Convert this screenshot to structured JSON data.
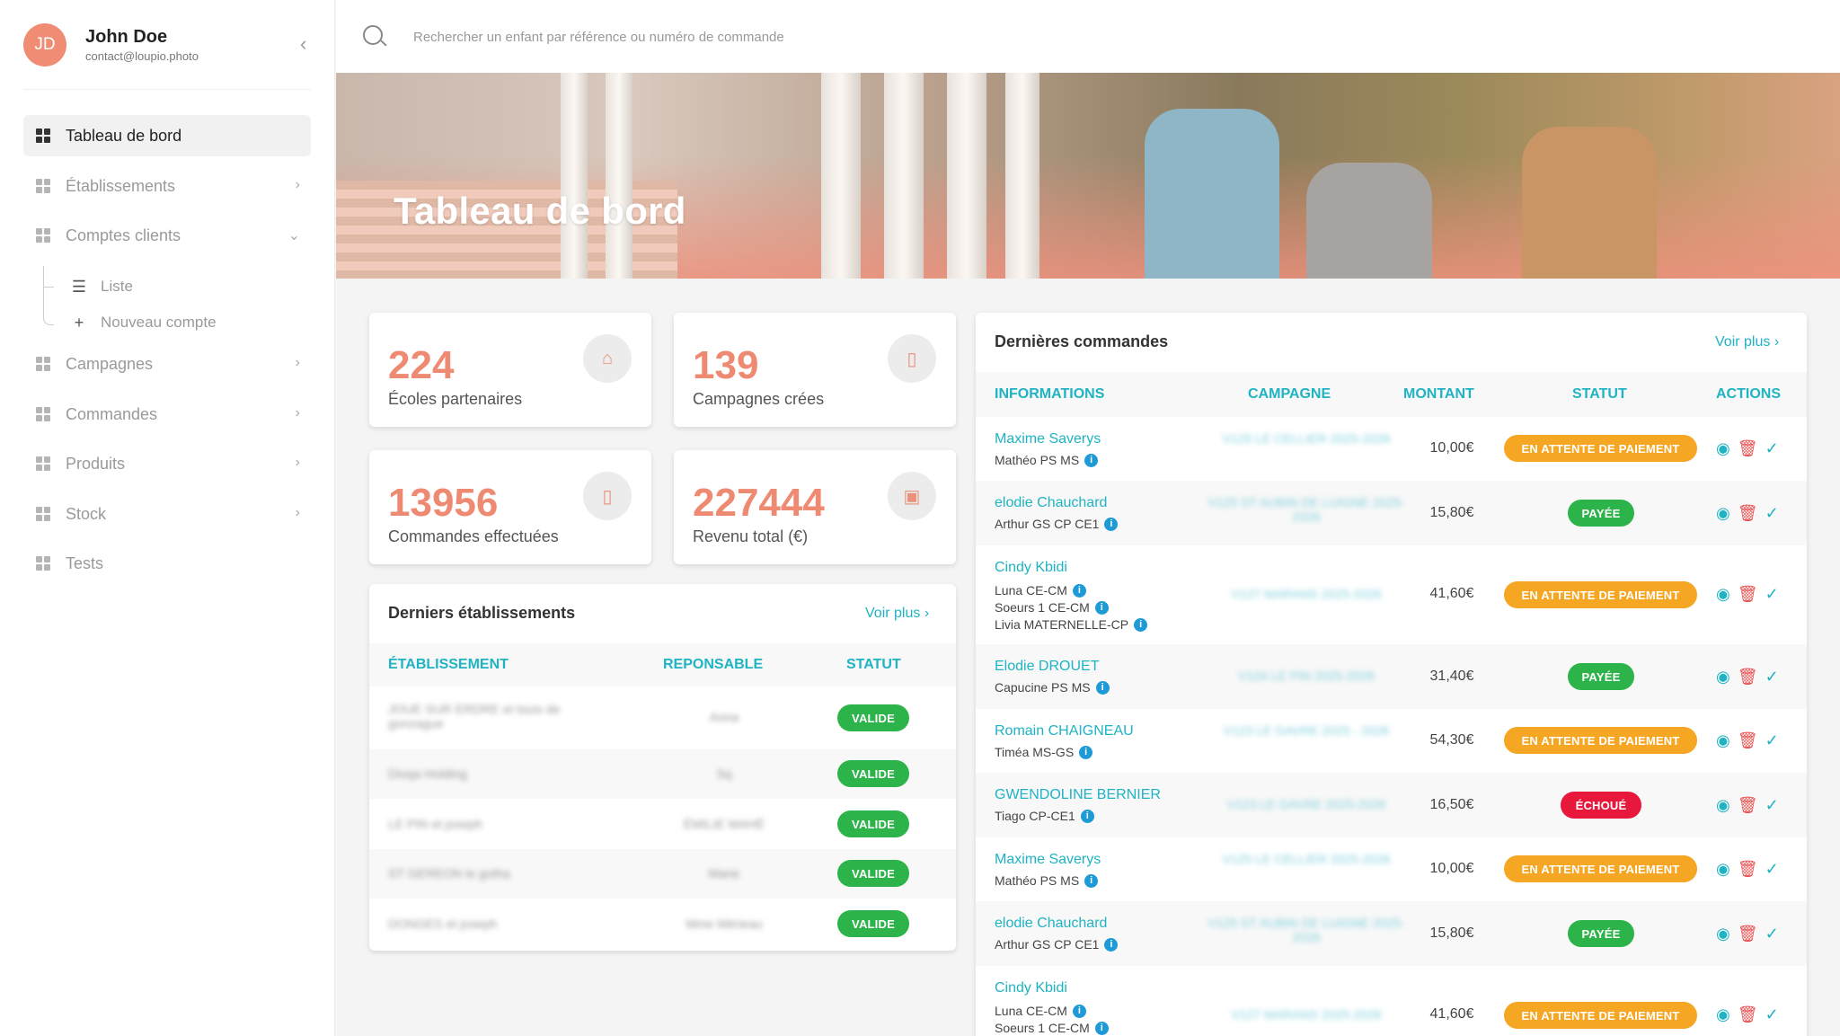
{
  "user": {
    "initials": "JD",
    "name": "John Doe",
    "email": "contact@loupio.photo"
  },
  "icons": {
    "collapse": "chevron-left-icon",
    "search": "search-icon",
    "nav": "grid-icon",
    "liste": "list-icon",
    "nouveau": "plus-icon",
    "chevron": "chevron-right-icon",
    "chevron_down": "chevron-down-icon",
    "school": "school-icon",
    "campaign": "document-icon",
    "orders": "document-check-icon",
    "revenue": "money-icon",
    "info": "info-icon",
    "view": "eye-icon",
    "delete": "trash-icon",
    "validate": "check-icon"
  },
  "sidebar": {
    "items": [
      {
        "label": "Tableau de bord"
      },
      {
        "label": "Établissements"
      },
      {
        "label": "Comptes clients"
      },
      {
        "label": "Campagnes"
      },
      {
        "label": "Commandes"
      },
      {
        "label": "Produits"
      },
      {
        "label": "Stock"
      },
      {
        "label": "Tests"
      }
    ],
    "subitems": [
      {
        "label": "Liste"
      },
      {
        "label": "Nouveau compte"
      }
    ]
  },
  "search": {
    "placeholder": "Rechercher un enfant par référence ou numéro de commande"
  },
  "banner": {
    "title": "Tableau de bord"
  },
  "stats": [
    {
      "value": "224",
      "label": "Écoles partenaires"
    },
    {
      "value": "139",
      "label": "Campagnes crées"
    },
    {
      "value": "13956",
      "label": "Commandes effectuées"
    },
    {
      "value": "227444",
      "label": "Revenu total (€)"
    }
  ],
  "establishments": {
    "title": "Derniers établissements",
    "more": "Voir plus",
    "headers": [
      "ÉTABLISSEMENT",
      "REPONSABLE",
      "STATUT"
    ],
    "rows": [
      {
        "name": "JOUE SUR ERDRE et louis de gonzague",
        "resp": "Anna",
        "status": "VALIDE"
      },
      {
        "name": "Dioqa Holding",
        "resp": "Sq",
        "status": "VALIDE"
      },
      {
        "name": "LE PIN et joseph",
        "resp": "ÉMILIE MAHÉ",
        "status": "VALIDE"
      },
      {
        "name": "ST GEREON le gotha",
        "resp": "Marie",
        "status": "VALIDE"
      },
      {
        "name": "DONGES et joseph",
        "resp": "Mme Mérieau",
        "status": "VALIDE"
      }
    ]
  },
  "orders": {
    "title": "Dernières commandes",
    "more": "Voir plus",
    "headers": [
      "INFORMATIONS",
      "CAMPAGNE",
      "MONTANT",
      "STATUT",
      "ACTIONS"
    ],
    "rows": [
      {
        "customer": "Maxime Saverys",
        "children": [
          "Mathéo PS MS"
        ],
        "campaign": "V125 LE CELLIER 2025-2026",
        "amount": "10,00€",
        "status": "EN ATTENTE DE PAIEMENT",
        "kind": "attente"
      },
      {
        "customer": "elodie Chauchard",
        "children": [
          "Arthur GS CP CE1"
        ],
        "campaign": "V125 ST AUBIN DE LUIGNE 2025-2026",
        "amount": "15,80€",
        "status": "PAYÉE",
        "kind": "payee"
      },
      {
        "customer": "Cindy Kbidi",
        "children": [
          "Luna CE-CM",
          "Soeurs 1 CE-CM",
          "Livia MATERNELLE-CP"
        ],
        "campaign": "V127 MARANS 2025-2026",
        "amount": "41,60€",
        "status": "EN ATTENTE DE PAIEMENT",
        "kind": "attente"
      },
      {
        "customer": "Elodie DROUET",
        "children": [
          "Capucine PS MS"
        ],
        "campaign": "V124 LE PIN 2025-2026",
        "amount": "31,40€",
        "status": "PAYÉE",
        "kind": "payee"
      },
      {
        "customer": "Romain CHAIGNEAU",
        "children": [
          "Timéa MS-GS"
        ],
        "campaign": "V123 LE GAVRE 2025 - 2026",
        "amount": "54,30€",
        "status": "EN ATTENTE DE PAIEMENT",
        "kind": "attente"
      },
      {
        "customer": "GWENDOLINE BERNIER",
        "children": [
          "Tiago CP-CE1"
        ],
        "campaign": "V123 LE GAVRE 2025-2026",
        "amount": "16,50€",
        "status": "ÉCHOUÉ",
        "kind": "echoue"
      },
      {
        "customer": "Maxime Saverys",
        "children": [
          "Mathéo PS MS"
        ],
        "campaign": "V125 LE CELLIER 2025-2026",
        "amount": "10,00€",
        "status": "EN ATTENTE DE PAIEMENT",
        "kind": "attente"
      },
      {
        "customer": "elodie Chauchard",
        "children": [
          "Arthur GS CP CE1"
        ],
        "campaign": "V125 ST AUBIN DE LUIGNE 2025-2026",
        "amount": "15,80€",
        "status": "PAYÉE",
        "kind": "payee"
      },
      {
        "customer": "Cindy Kbidi",
        "children": [
          "Luna CE-CM",
          "Soeurs 1 CE-CM"
        ],
        "campaign": "V127 MARANS 2025-2026",
        "amount": "41,60€",
        "status": "EN ATTENTE DE PAIEMENT",
        "kind": "attente"
      }
    ]
  }
}
